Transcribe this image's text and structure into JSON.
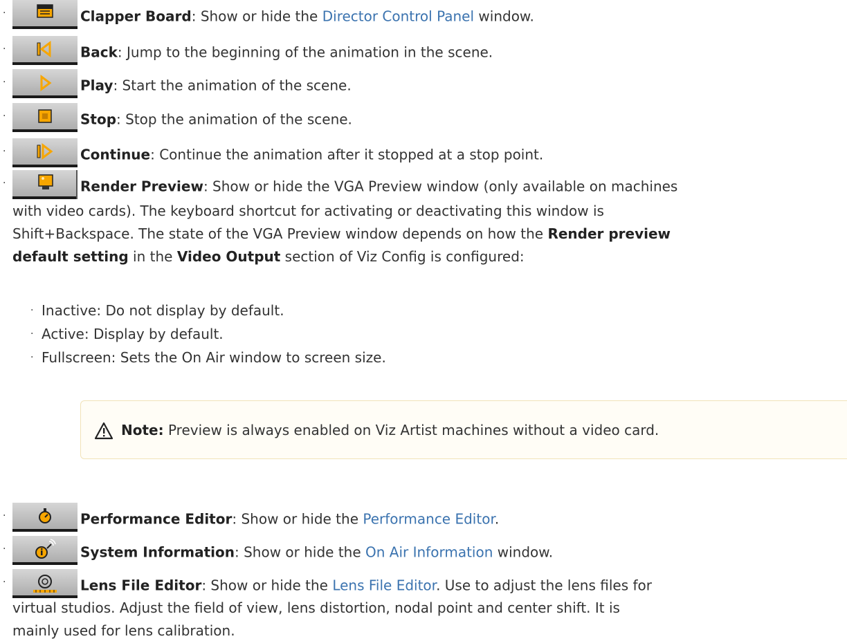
{
  "items": [
    {
      "icon": "clapper-board-icon",
      "title": "Clapper Board",
      "pre": ": Show or hide the ",
      "link": "Director Control Panel",
      "post": " window."
    },
    {
      "icon": "back-icon",
      "title": "Back",
      "text": ": Jump to the beginning of the animation in the scene."
    },
    {
      "icon": "play-icon",
      "title": "Play",
      "text": ": Start the animation of the scene."
    },
    {
      "icon": "stop-icon",
      "title": "Stop",
      "text": ": Stop the animation of the scene."
    },
    {
      "icon": "continue-icon",
      "title": "Continue",
      "text": ": Continue the animation after it stopped at a stop point."
    }
  ],
  "render_preview": {
    "title": "Render Preview",
    "line1": ": Show or hide the VGA Preview window (only available on machines",
    "line2": "with video cards). The keyboard shortcut for activating or deactivating this window is",
    "line3_a": "Shift+Backspace. The state of the VGA Preview window depends on how the ",
    "line3_b": "Render preview",
    "line4_a": "default setting",
    "line4_b": " in the ",
    "line4_c": "Video Output",
    "line4_d": " section of Viz Config is configured:",
    "options": [
      "Inactive: Do not display by default.",
      "Active: Display by default.",
      "Fullscreen: Sets the On Air window to screen size."
    ]
  },
  "note": {
    "label": "Note:",
    "text": " Preview is always enabled on Viz Artist machines without a video card."
  },
  "items2": [
    {
      "icon": "performance-editor-icon",
      "title": "Performance Editor",
      "pre": ": Show or hide the ",
      "link": "Performance Editor",
      "post": "."
    },
    {
      "icon": "system-information-icon",
      "title": "System Information",
      "pre": ": Show or hide the ",
      "link": "On Air Information",
      "post": " window."
    }
  ],
  "lens": {
    "title": "Lens File Editor",
    "pre": ": Show or hide the ",
    "link": "Lens File Editor",
    "post": ". Use to adjust the lens files for",
    "line2": "virtual studios. Adjust the field of view, lens distortion, nodal point and center shift. It is",
    "line3": "mainly used for lens calibration."
  },
  "colors": {
    "link": "#3b73af",
    "note_bg": "#fffdf6",
    "note_border": "#f1e3b8",
    "icon_orange": "#f7a600"
  }
}
